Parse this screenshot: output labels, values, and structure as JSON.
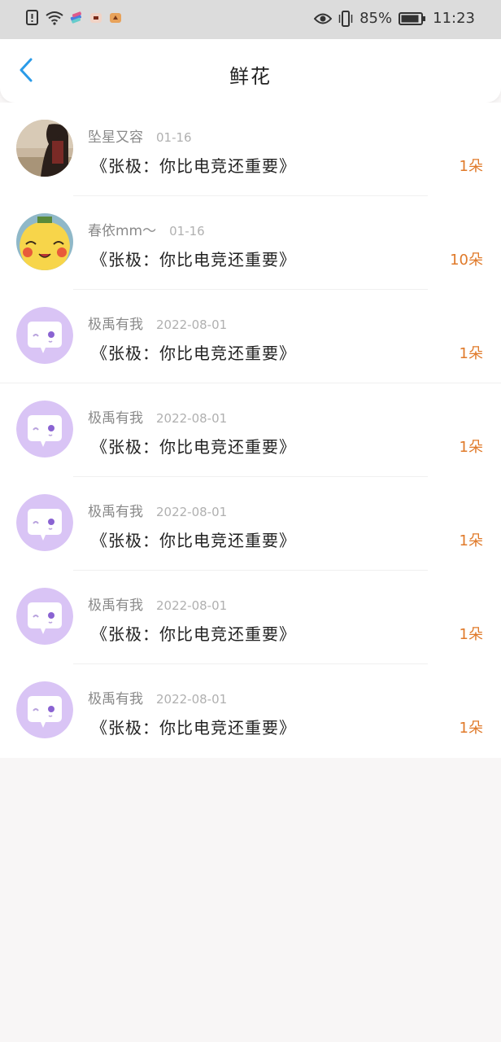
{
  "status": {
    "battery": "85%",
    "time": "11:23"
  },
  "header": {
    "title": "鲜花"
  },
  "items": [
    {
      "name": "坠星又容",
      "date": "01-16",
      "message": "《张极：你比电竞还重要》",
      "count": "1朵",
      "avatar": "photo"
    },
    {
      "name": "春依mm～",
      "date": "01-16",
      "message": "《张极：你比电竞还重要》",
      "count": "10朵",
      "avatar": "pikachu"
    },
    {
      "name": "极禹有我",
      "date": "2022-08-01",
      "message": "《张极：你比电竞还重要》",
      "count": "1朵",
      "avatar": "chat-bubble-default"
    },
    {
      "name": "极禹有我",
      "date": "2022-08-01",
      "message": "《张极：你比电竞还重要》",
      "count": "1朵",
      "avatar": "chat-bubble-default"
    },
    {
      "name": "极禹有我",
      "date": "2022-08-01",
      "message": "《张极：你比电竞还重要》",
      "count": "1朵",
      "avatar": "chat-bubble-default"
    },
    {
      "name": "极禹有我",
      "date": "2022-08-01",
      "message": "《张极：你比电竞还重要》",
      "count": "1朵",
      "avatar": "chat-bubble-default"
    },
    {
      "name": "极禹有我",
      "date": "2022-08-01",
      "message": "《张极：你比电竞还重要》",
      "count": "1朵",
      "avatar": "chat-bubble-default"
    }
  ],
  "colors": {
    "accent": "#2a9be8",
    "count": "#e07a2a",
    "avatar_default_bg": "#d9c4f5"
  }
}
